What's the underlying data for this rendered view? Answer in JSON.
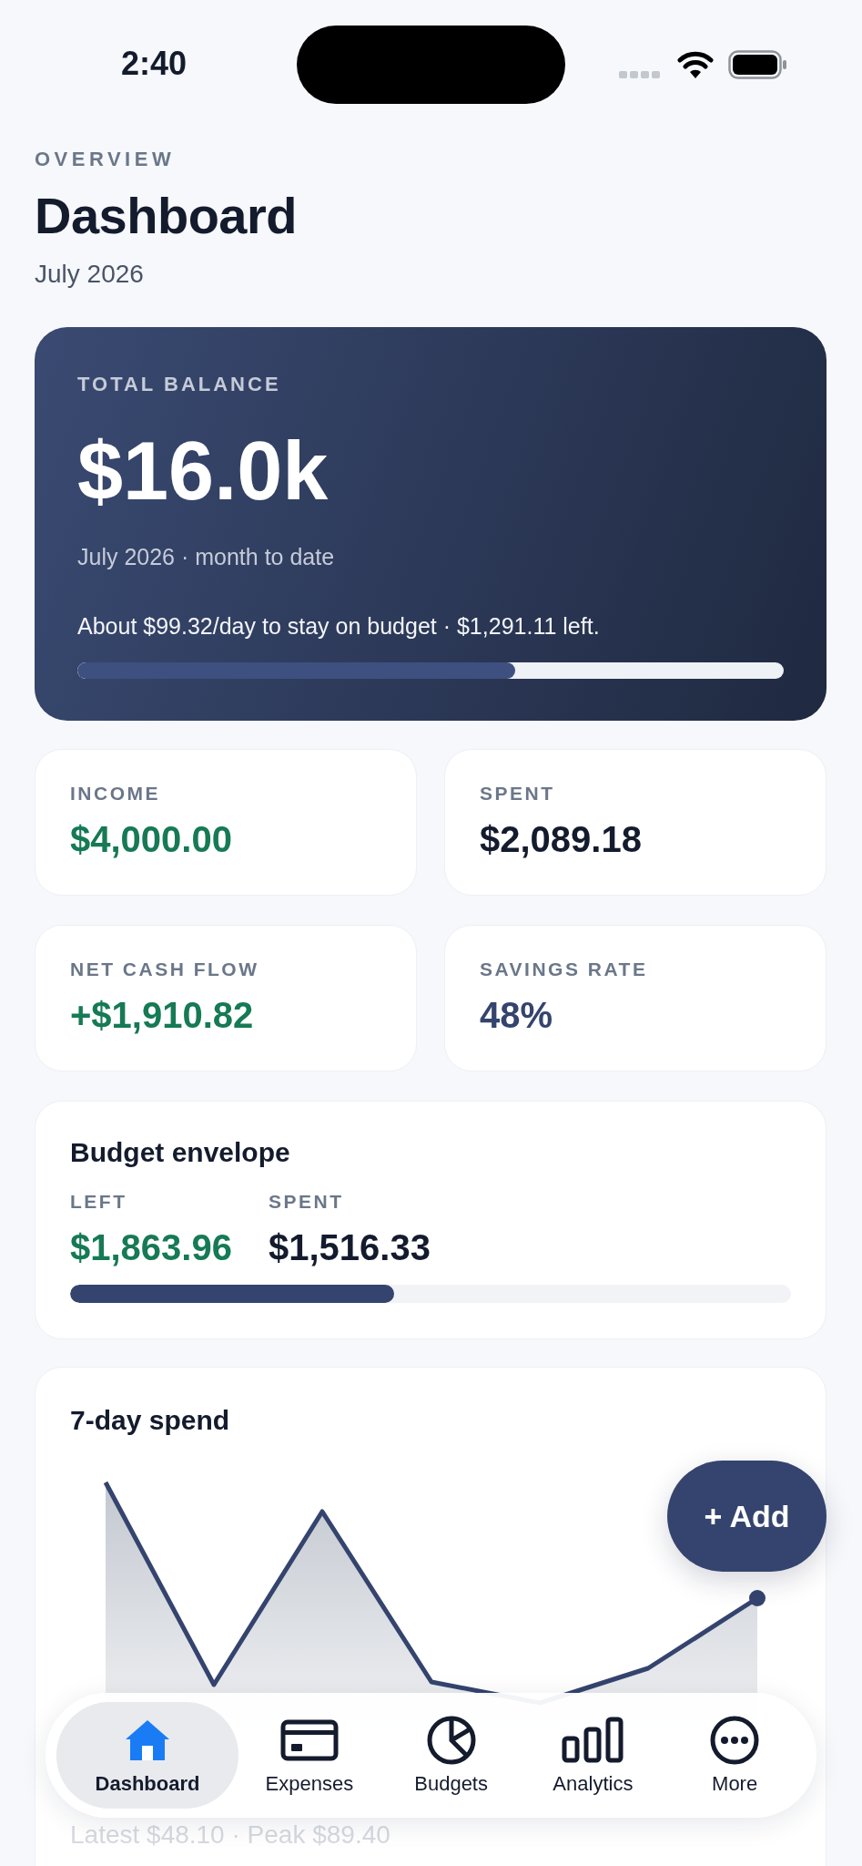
{
  "status_bar": {
    "time": "2:40"
  },
  "header": {
    "eyebrow": "OVERVIEW",
    "title": "Dashboard",
    "subtitle": "July 2026"
  },
  "balance": {
    "label": "TOTAL BALANCE",
    "amount": "$16.0k",
    "period": "July 2026 · month to date",
    "note": "About $99.32/day to stay on budget · $1,291.11 left.",
    "level": 0.62
  },
  "stats": [
    {
      "label": "INCOME",
      "value": "$4,000.00",
      "color": "#167a55"
    },
    {
      "label": "SPENT",
      "value": "$2,089.18",
      "color": "#141b2d"
    },
    {
      "label": "NET CASH FLOW",
      "value": "+$1,910.82",
      "color": "#167a55"
    },
    {
      "label": "SAVINGS RATE",
      "value": "48%",
      "color": "#34446e"
    }
  ],
  "budget": {
    "title": "Budget envelope",
    "figures": [
      {
        "label": "LEFT",
        "value": "$1,863.96",
        "color": "#167a55"
      },
      {
        "label": "SPENT",
        "value": "$1,516.33",
        "color": "#141b2d"
      }
    ],
    "level": 0.45
  },
  "spend": {
    "title": "7-day spend",
    "caption": "Latest $48.10 · Peak $89.40"
  },
  "add_button": {
    "label": "+ Add"
  },
  "tabs": [
    {
      "label": "Dashboard",
      "kind": "house",
      "selected": true
    },
    {
      "label": "Expenses",
      "kind": "card",
      "selected": false
    },
    {
      "label": "Budgets",
      "kind": "pie",
      "selected": false
    },
    {
      "label": "Analytics",
      "kind": "bars",
      "selected": false
    },
    {
      "label": "More",
      "kind": "more",
      "selected": false
    }
  ]
}
